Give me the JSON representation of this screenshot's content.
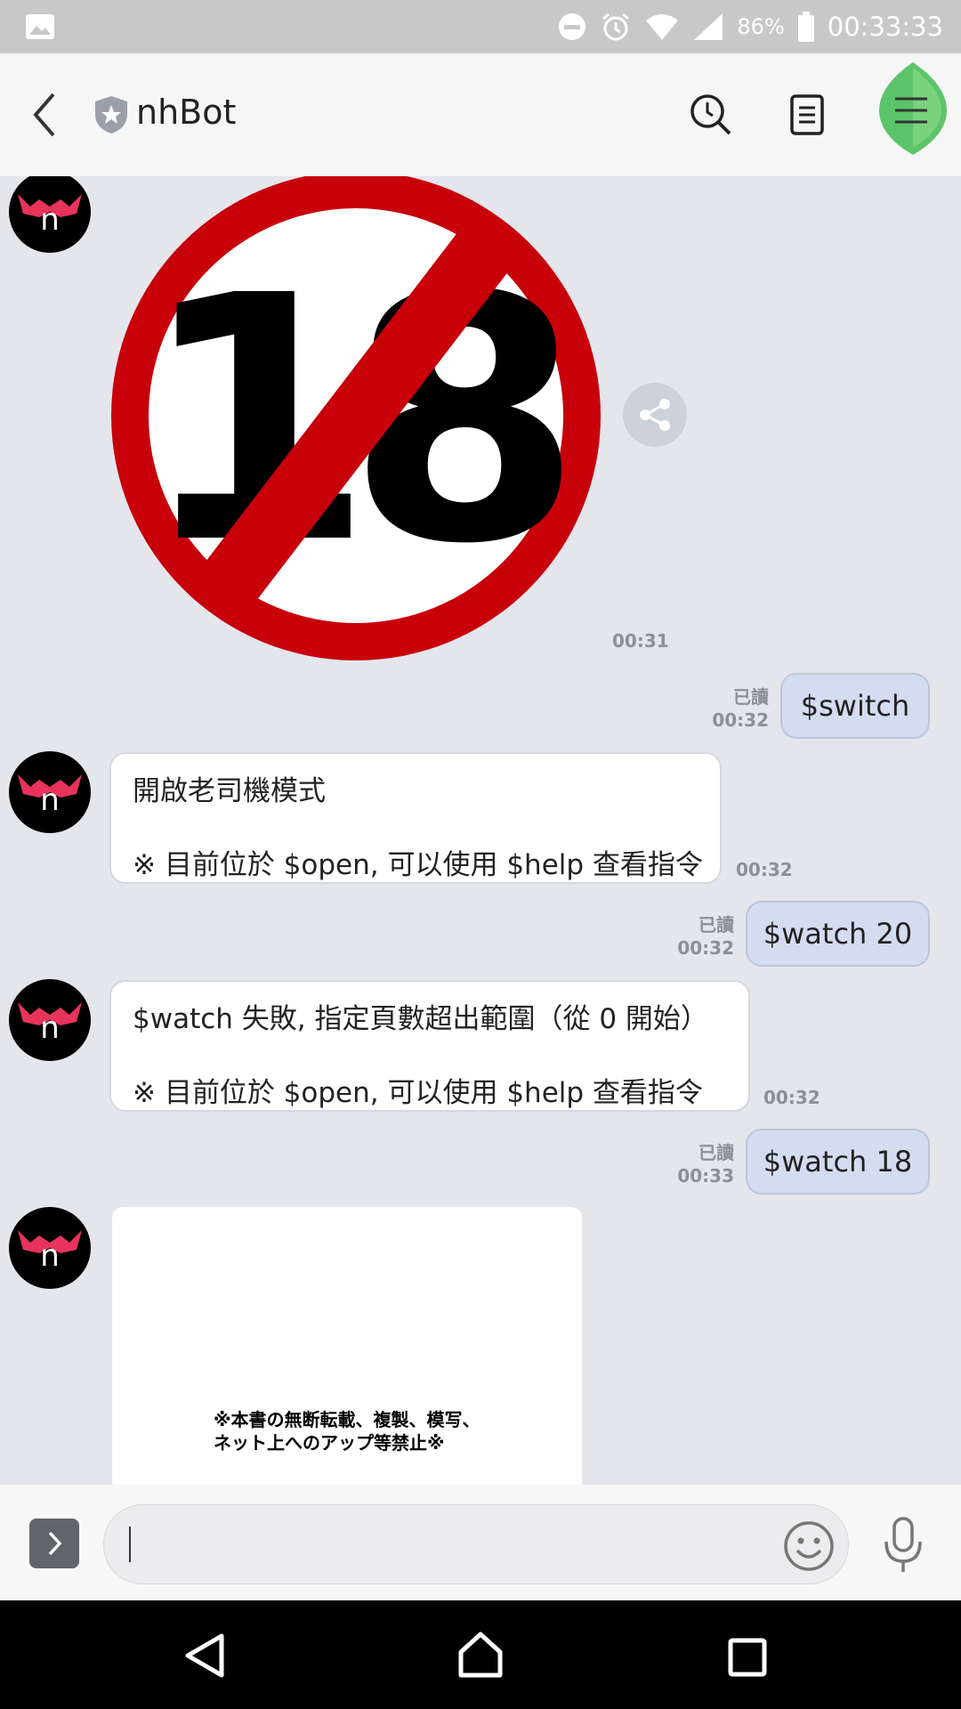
{
  "status_bar": {
    "battery_percent": "86%",
    "time": "00:33:33",
    "icons": [
      "gallery-icon",
      "dnd-icon",
      "alarm-icon",
      "wifi-icon",
      "signal-icon",
      "battery-icon"
    ]
  },
  "header": {
    "title": "nhBot",
    "icons": [
      "back-icon",
      "official-shield-icon",
      "search-icon",
      "notes-icon",
      "menu-icon"
    ]
  },
  "messages": {
    "m1_time": "00:31",
    "m2": {
      "read": "已讀",
      "time": "00:32",
      "text": "$switch"
    },
    "m3": {
      "line1": "開啟老司機模式",
      "line2": "※ 目前位於 $open, 可以使用 $help 查看指令",
      "time": "00:32"
    },
    "m4": {
      "read": "已讀",
      "time": "00:32",
      "text": "$watch 20"
    },
    "m5": {
      "line1": "$watch 失敗, 指定頁數超出範圍（從 0 開始）",
      "line2": "※ 目前位於 $open, 可以使用 $help 查看指令",
      "time": "00:32"
    },
    "m6": {
      "read": "已讀",
      "time": "00:33",
      "text": "$watch 18"
    },
    "m7": {
      "image_line1": "※本書の無断転載、複製、模写、",
      "image_line2": "ネット上へのアップ等禁止※"
    }
  },
  "input": {
    "value": "",
    "placeholder": ""
  },
  "colors": {
    "outgoing_bubble": "#d3dcf0",
    "incoming_bubble": "#ffffff",
    "chat_background": "#e4e6ec",
    "prohibition_red": "#c8000a",
    "avatar_accent": "#e8345a",
    "menu_leaf": "#5cc46a"
  }
}
